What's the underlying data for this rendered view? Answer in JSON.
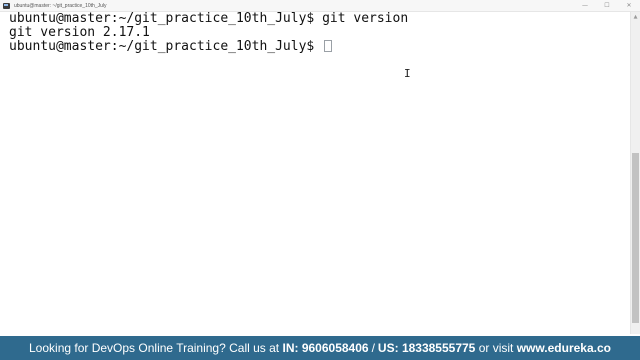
{
  "window": {
    "title": "ubuntu@master: ~/git_practice_10th_July",
    "minimize_glyph": "—",
    "maximize_glyph": "☐",
    "close_glyph": "✕"
  },
  "terminal": {
    "lines": [
      "ubuntu@master:~/git_practice_10th_July$ git version",
      "git version 2.17.1",
      "ubuntu@master:~/git_practice_10th_July$ "
    ]
  },
  "banner": {
    "lead": "Looking for DevOps Online Training? Call us at",
    "in_label": "IN:",
    "in_number": "9606058406",
    "separator": "/",
    "us_label": "US:",
    "us_number": "18338555775",
    "or_visit": "or visit",
    "site": "www.edureka.co"
  },
  "colors": {
    "banner_bg": "#2f6a8e",
    "terminal_bg": "#ffffff",
    "terminal_fg": "#111111"
  },
  "icons": {
    "app_icon": "terminal-icon",
    "text_cursor": "ibeam-cursor-icon"
  }
}
